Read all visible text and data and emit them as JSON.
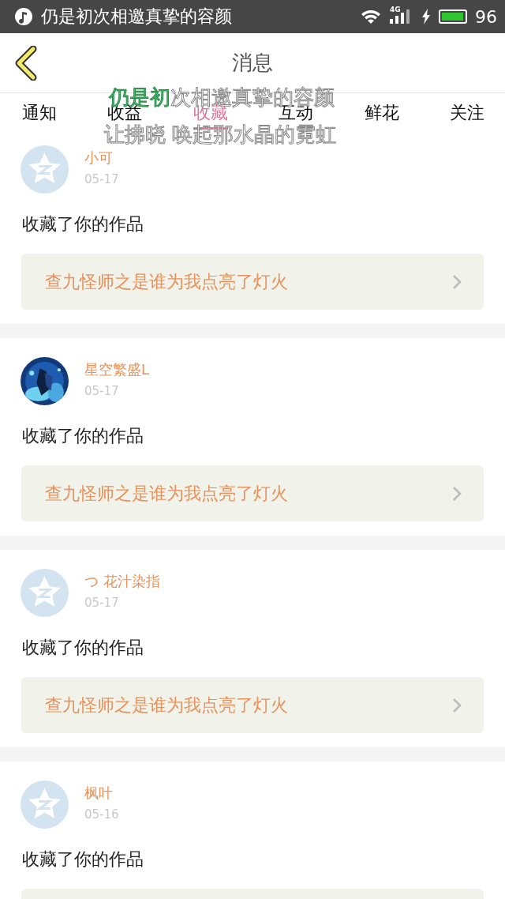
{
  "status_bar": {
    "notification": "仍是初次相邀真挚的容颜",
    "network": "4G",
    "battery_text": "96"
  },
  "header": {
    "title": "消息"
  },
  "tabs": [
    {
      "label": "通知",
      "selected": false
    },
    {
      "label": "收益",
      "selected": false
    },
    {
      "label": "收藏",
      "selected": true
    },
    {
      "label": "互动",
      "selected": false
    },
    {
      "label": "鲜花",
      "selected": false
    },
    {
      "label": "关注",
      "selected": false
    }
  ],
  "lyrics_overlay": [
    {
      "sung": "仍是初",
      "unsung": "次相邀真挚的容颜"
    },
    {
      "unsung": "让拂晓 唤起那水晶的霓虹"
    }
  ],
  "messages": [
    {
      "kind": "default",
      "name": "小可",
      "date": "05-17",
      "action": "收藏了你的作品",
      "work": "查九怪师之是谁为我点亮了灯火"
    },
    {
      "kind": "picture",
      "name": "星空繁盛L",
      "date": "05-17",
      "action": "收藏了你的作品",
      "work": "查九怪师之是谁为我点亮了灯火"
    },
    {
      "kind": "default",
      "name": "つ 花汁染指",
      "date": "05-17",
      "action": "收藏了你的作品",
      "work": "查九怪师之是谁为我点亮了灯火"
    },
    {
      "kind": "default",
      "name": "枫叶",
      "date": "05-16",
      "action": "收藏了你的作品"
    }
  ]
}
